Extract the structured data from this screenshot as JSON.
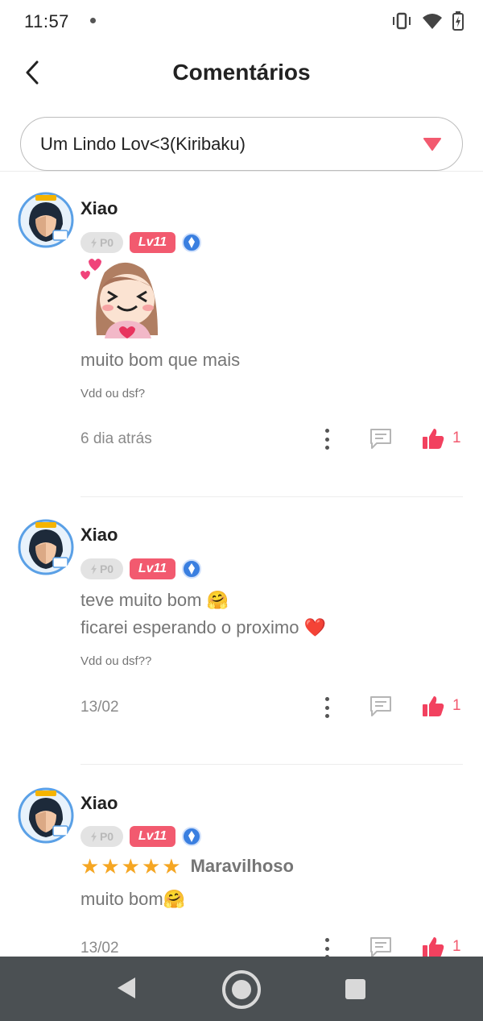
{
  "status_bar": {
    "time": "11:57"
  },
  "header": {
    "title": "Comentários"
  },
  "chapter_select": {
    "value": "Um Lindo Lov<3(Kiribaku)"
  },
  "badges": {
    "p0": "P0",
    "level": "Lv11"
  },
  "comments": [
    {
      "user": "Xiao",
      "text_lines": [
        "muito bom que mais"
      ],
      "reply_note": "Vdd ou dsf?",
      "time": "6 dia atrás",
      "likes": "1"
    },
    {
      "user": "Xiao",
      "text_lines": [
        "teve muito bom 🤗",
        "ficarei esperando o proximo ❤️"
      ],
      "reply_note": "Vdd ou dsf??",
      "time": "13/02",
      "likes": "1"
    },
    {
      "user": "Xiao",
      "rating": {
        "stars": 5,
        "label": "Maravilhoso"
      },
      "text_lines": [
        "muito bom🤗"
      ],
      "time": "13/02",
      "likes": "1"
    }
  ],
  "colors": {
    "accent": "#f25a6f",
    "star": "#f5a623",
    "nav_bar": "#4b5053"
  },
  "icons": [
    "back-arrow-icon",
    "vibrate-icon",
    "wifi-icon",
    "battery-icon",
    "dropdown-triangle-icon",
    "more-vertical-icon",
    "reply-comment-icon",
    "thumbs-up-icon",
    "lightning-icon",
    "ribbon-icon"
  ]
}
